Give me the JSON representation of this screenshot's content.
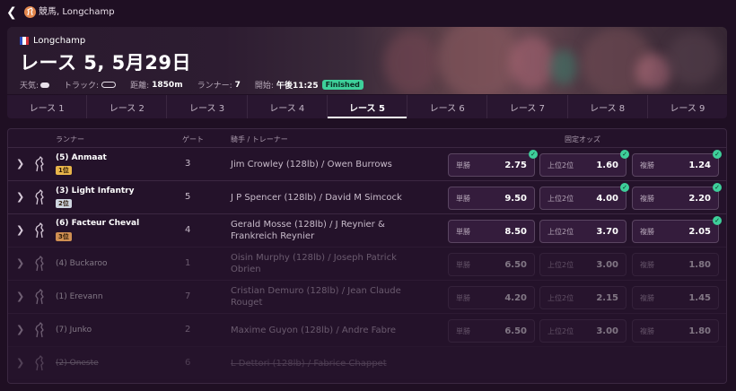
{
  "topbar": {
    "crumb": "競馬, Longchamp"
  },
  "hero": {
    "course": "Longchamp",
    "title": "レース 5, 5月29日",
    "weather_label": "天気:",
    "track_label": "トラック:",
    "distance_label": "距離:",
    "distance": "1850m",
    "runners_label": "ランナー:",
    "runners": "7",
    "start_label": "開始:",
    "start": "午後11:25",
    "status": "Finished"
  },
  "tabs": [
    "レース 1",
    "レース 2",
    "レース 3",
    "レース 4",
    "レース 5",
    "レース 6",
    "レース 7",
    "レース 8",
    "レース 9"
  ],
  "table": {
    "headers": {
      "runner": "ランナー",
      "gate": "ゲート",
      "jockey": "騎手 / トレーナー",
      "odds": "固定オッズ"
    },
    "odds_labels": [
      "単勝",
      "上位2位",
      "複勝"
    ],
    "rows": [
      {
        "name": "(5) Anmaat",
        "badge": "1位",
        "gate": "3",
        "jockey": "Jim Crowley (128lb) / Owen Burrows",
        "odds": [
          "2.75",
          "1.60",
          "1.24"
        ]
      },
      {
        "name": "(3) Light Infantry",
        "badge": "2位",
        "gate": "5",
        "jockey": "J P Spencer (128lb) / David M Simcock",
        "odds": [
          "9.50",
          "4.00",
          "2.20"
        ]
      },
      {
        "name": "(6) Facteur Cheval",
        "badge": "3位",
        "gate": "4",
        "jockey": "Gerald Mosse (128lb) / J Reynier & Frankreich Reynier",
        "odds": [
          "8.50",
          "3.70",
          "2.05"
        ]
      },
      {
        "name": "(4) Buckaroo",
        "badge": "",
        "gate": "1",
        "jockey": "Oisin Murphy (128lb) / Joseph Patrick Obrien",
        "odds": [
          "6.50",
          "3.00",
          "1.80"
        ]
      },
      {
        "name": "(1) Erevann",
        "badge": "",
        "gate": "7",
        "jockey": "Cristian Demuro (128lb) / Jean Claude Rouget",
        "odds": [
          "4.20",
          "2.15",
          "1.45"
        ]
      },
      {
        "name": "(7) Junko",
        "badge": "",
        "gate": "2",
        "jockey": "Maxime Guyon (128lb) / Andre Fabre",
        "odds": [
          "6.50",
          "3.00",
          "1.80"
        ]
      },
      {
        "name": "(2) Oneste",
        "badge": "",
        "gate": "6",
        "jockey": "L Dettori (128lb) / Fabrice Chappet",
        "odds": []
      }
    ]
  },
  "colors": {
    "accent_green": "#3ecf9a",
    "badge_gold": "#e8b54a",
    "badge_silver": "#cfd6e0",
    "badge_bronze": "#cf8f52"
  }
}
